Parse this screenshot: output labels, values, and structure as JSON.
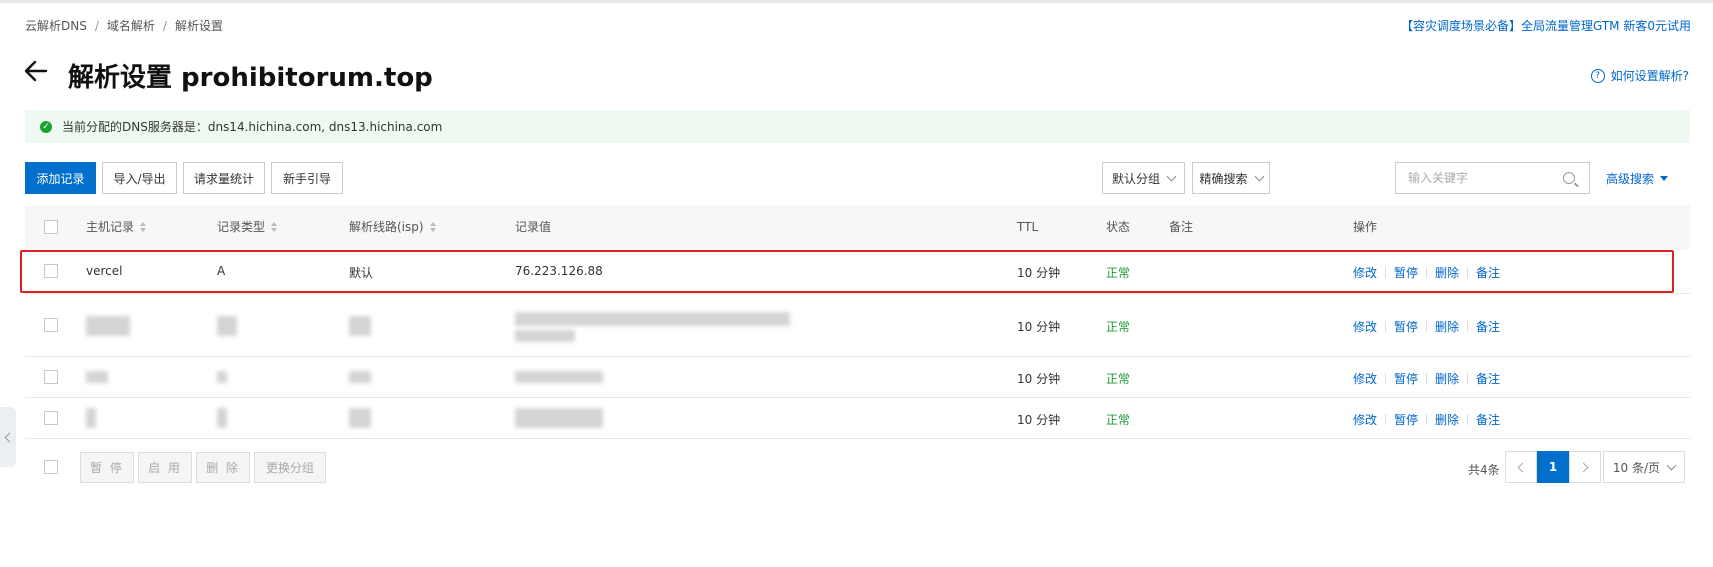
{
  "breadcrumb": [
    "云解析DNS",
    "域名解析",
    "解析设置"
  ],
  "promo": "【容灾调度场景必备】全局流量管理GTM 新客0元试用",
  "title": "解析设置 prohibitorum.top",
  "help_link": "如何设置解析?",
  "notice": "当前分配的DNS服务器是：dns14.hichina.com, dns13.hichina.com",
  "toolbar": {
    "add": "添加记录",
    "import_export": "导入/导出",
    "stats": "请求量统计",
    "guide": "新手引导",
    "group": "默认分组",
    "search_mode": "精确搜索",
    "search_placeholder": "输入关键字",
    "advanced": "高级搜索"
  },
  "columns": {
    "host": "主机记录",
    "type": "记录类型",
    "line": "解析线路(isp)",
    "value": "记录值",
    "ttl": "TTL",
    "status": "状态",
    "remark": "备注",
    "ops": "操作"
  },
  "rows": [
    {
      "host": "vercel",
      "type": "A",
      "line": "默认",
      "value": "76.223.126.88",
      "ttl": "10 分钟",
      "status": "正常"
    },
    {
      "host": "",
      "type": "",
      "line": "",
      "value": "",
      "ttl": "10 分钟",
      "status": "正常"
    },
    {
      "host": "",
      "type": "",
      "line": "",
      "value": "",
      "ttl": "10 分钟",
      "status": "正常"
    },
    {
      "host": "",
      "type": "",
      "line": "",
      "value": "",
      "ttl": "10 分钟",
      "status": "正常"
    }
  ],
  "row_ops": {
    "edit": "修改",
    "pause": "暂停",
    "delete": "删除",
    "remark": "备注"
  },
  "bulk": {
    "pause": "暂 停",
    "enable": "启 用",
    "delete": "删 除",
    "change_group": "更换分组"
  },
  "pagination": {
    "total": "共4条",
    "current": "1",
    "page_size": "10 条/页"
  },
  "colors": {
    "primary": "#0070cc",
    "link": "#0066cc",
    "success": "#1e9e35",
    "highlight": "#e02020"
  },
  "icons": [
    "back-arrow-icon",
    "help-circle-icon",
    "check-circle-icon",
    "search-icon",
    "sort-icon",
    "chevron-down-icon",
    "chevron-left-icon",
    "chevron-right-icon"
  ]
}
